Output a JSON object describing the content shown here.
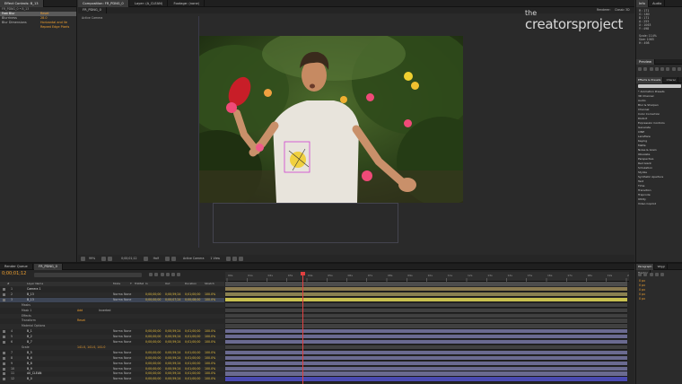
{
  "top_left": {
    "tab_label": "Effect Controls: B_13",
    "comp_path": "FR_PDNG_0 • B_13",
    "rows": [
      {
        "label": "Fast Blur",
        "value": "Reset",
        "sel": true
      },
      {
        "label": "Blurriness",
        "value": "28.0"
      },
      {
        "label": "Blur Dimensions",
        "value": "Horizontal and Ve"
      },
      {
        "label": "",
        "value": "Repeat Edge Pixels"
      }
    ]
  },
  "composition": {
    "tab_label": "Composition: FR_PDNG_0",
    "flow_tab": "FR_PDNG_0",
    "layer_tab": "Layer: (A_CLEAN)",
    "footage_tab": "Footage: (none)",
    "renderer_label": "Renderer:",
    "renderer_value": "Classic 3D",
    "active_camera": "Active Camera",
    "zoom": "99%",
    "timecode": "0;00;01;12",
    "resolution": "Half",
    "camera_select": "Active Camera",
    "view_select": "1 View"
  },
  "watermark": {
    "line1": "the",
    "line2": "creatorsproject"
  },
  "info_panel": {
    "tabs": [
      "Info",
      "Audio"
    ],
    "lines": [
      "R : 171",
      "G : 180",
      "B : 171",
      "A : 255",
      "X : 1063",
      "Y : 498",
      "",
      "Scale: 114%",
      "Size: 1065",
      "H : 498"
    ]
  },
  "preview": {
    "tab_label": "Preview"
  },
  "effects": {
    "tabs": [
      "Effects & Presets",
      "Charac"
    ],
    "items": [
      "* Animation Presets",
      "3D Channel",
      "Audio",
      "Blur & Sharpen",
      "Channel",
      "Color Correction",
      "Distort",
      "Expression Controls",
      "Generate",
      "CINE",
      "Lensflare",
      "Keying",
      "Matte",
      "Noise & Grain",
      "Obsolete",
      "Perspective",
      "Red Giant",
      "Simulation",
      "Stylize",
      "Synthetic Aperture",
      "Text",
      "Time",
      "Transition",
      "Trapcode",
      "Utility",
      "Video Copilot"
    ]
  },
  "paragraph": {
    "tabs": [
      "Paragraph",
      "Wiggl",
      "Tracker"
    ],
    "values": [
      "0 px",
      "0 px",
      "0 px",
      "0 px",
      "0 px"
    ]
  },
  "timeline": {
    "tab_render": "Render Queue",
    "tab_comp": "FR_PDNG_0",
    "current_time": "0;00;01;12",
    "col_headers": [
      "#",
      "Layer Name",
      "Mode",
      "T",
      "TrkMat",
      "In",
      "Out",
      "Duration",
      "Stretch"
    ],
    "ruler_ticks": [
      "00s",
      "01s",
      "02s",
      "03s",
      "04s",
      "05s",
      "06s",
      "07s",
      "08s",
      "09s",
      "10s",
      "11s",
      "12s",
      "13s",
      "14s",
      "15s",
      "16s",
      "17s",
      "18s",
      "19s",
      "20s"
    ],
    "rows": [
      {
        "num": "1",
        "name": "Camera 1",
        "mode": "",
        "trk": "",
        "in": "",
        "out": "",
        "dur": "",
        "str": "",
        "bar": "#8a7a50"
      },
      {
        "num": "2",
        "name": "B_13",
        "mode": "Norma",
        "trk": "None",
        "in": "0;00;00;00",
        "out": "0;00;59;24",
        "dur": "0;01;00;00",
        "str": "100.0%",
        "bar": "#8a8150"
      },
      {
        "num": "3",
        "name": "B_13",
        "mode": "Norma",
        "trk": "None",
        "in": "0;00;00;00",
        "out": "0;00;07;24",
        "dur": "0;00;08;00",
        "str": "100.0%",
        "bar": "#c8c050",
        "sel": true
      },
      {
        "num": "",
        "name": "Masks",
        "mode": "",
        "trk": "",
        "in": "",
        "out": "",
        "dur": "",
        "str": "",
        "bar": "#404040"
      },
      {
        "num": "",
        "name": "Mask 1",
        "mode": "Add",
        "trk": "Inverted",
        "in": "",
        "out": "",
        "dur": "",
        "str": "",
        "bar": "#404040"
      },
      {
        "num": "",
        "name": "Effects",
        "mode": "",
        "trk": "",
        "in": "",
        "out": "",
        "dur": "",
        "str": "",
        "bar": "#404040"
      },
      {
        "num": "",
        "name": "Transform",
        "mode": "Reset",
        "trk": "",
        "in": "",
        "out": "",
        "dur": "",
        "str": "",
        "bar": "#404040"
      },
      {
        "num": "",
        "name": "Material Options",
        "mode": "",
        "trk": "",
        "in": "",
        "out": "",
        "dur": "",
        "str": "",
        "bar": "#404040"
      },
      {
        "num": "4",
        "name": "B_1",
        "mode": "Norma",
        "trk": "None",
        "in": "0;00;00;00",
        "out": "0;00;59;24",
        "dur": "0;01;00;00",
        "str": "100.0%",
        "bar": "#6a6a90"
      },
      {
        "num": "5",
        "name": "B_2",
        "mode": "Norma",
        "trk": "None",
        "in": "0;00;00;00",
        "out": "0;00;59;24",
        "dur": "0;01;00;00",
        "str": "100.0%",
        "bar": "#6a6a90"
      },
      {
        "num": "6",
        "name": "B_7",
        "mode": "Norma",
        "trk": "None",
        "in": "0;00;00;00",
        "out": "0;00;59;24",
        "dur": "0;01;00;00",
        "str": "100.0%",
        "bar": "#6a6a90"
      },
      {
        "num": "",
        "name": "Scale",
        "mode": "141.0, 141.0, 141.0",
        "trk": "",
        "in": "",
        "out": "",
        "dur": "",
        "str": "",
        "bar": "#404040"
      },
      {
        "num": "7",
        "name": "B_5",
        "mode": "Norma",
        "trk": "None",
        "in": "0;00;00;00",
        "out": "0;00;59;24",
        "dur": "0;01;00;00",
        "str": "100.0%",
        "bar": "#6a6a90"
      },
      {
        "num": "8",
        "name": "B_6",
        "mode": "Norma",
        "trk": "None",
        "in": "0;00;00;00",
        "out": "0;00;59;24",
        "dur": "0;01;00;00",
        "str": "100.0%",
        "bar": "#6a6a90"
      },
      {
        "num": "9",
        "name": "B_8",
        "mode": "Norma",
        "trk": "None",
        "in": "0;00;00;00",
        "out": "0;00;59;24",
        "dur": "0;01;00;00",
        "str": "100.0%",
        "bar": "#6a6a90"
      },
      {
        "num": "10",
        "name": "B_9",
        "mode": "Norma",
        "trk": "None",
        "in": "0;00;00;00",
        "out": "0;00;59;24",
        "dur": "0;01;00;00",
        "str": "100.0%",
        "bar": "#6a6a90"
      },
      {
        "num": "11",
        "name": "A0_CLEAN",
        "mode": "Norma",
        "trk": "None",
        "in": "0;00;00;00",
        "out": "0;00;59;24",
        "dur": "0;01;00;00",
        "str": "100.0%",
        "bar": "#6a6a90"
      },
      {
        "num": "12",
        "name": "B_0",
        "mode": "Norma",
        "trk": "None",
        "in": "0;00;00;00",
        "out": "0;00;59;24",
        "dur": "0;01;00;00",
        "str": "100.0%",
        "bar": "#4a4ab0"
      }
    ]
  },
  "colors": {
    "panel_bg": "#2b2b2b",
    "dark_bg": "#1e1e1e",
    "accent_orange": "#f0a030",
    "cti_red": "#e04040",
    "selected_row": "#3d4555"
  }
}
